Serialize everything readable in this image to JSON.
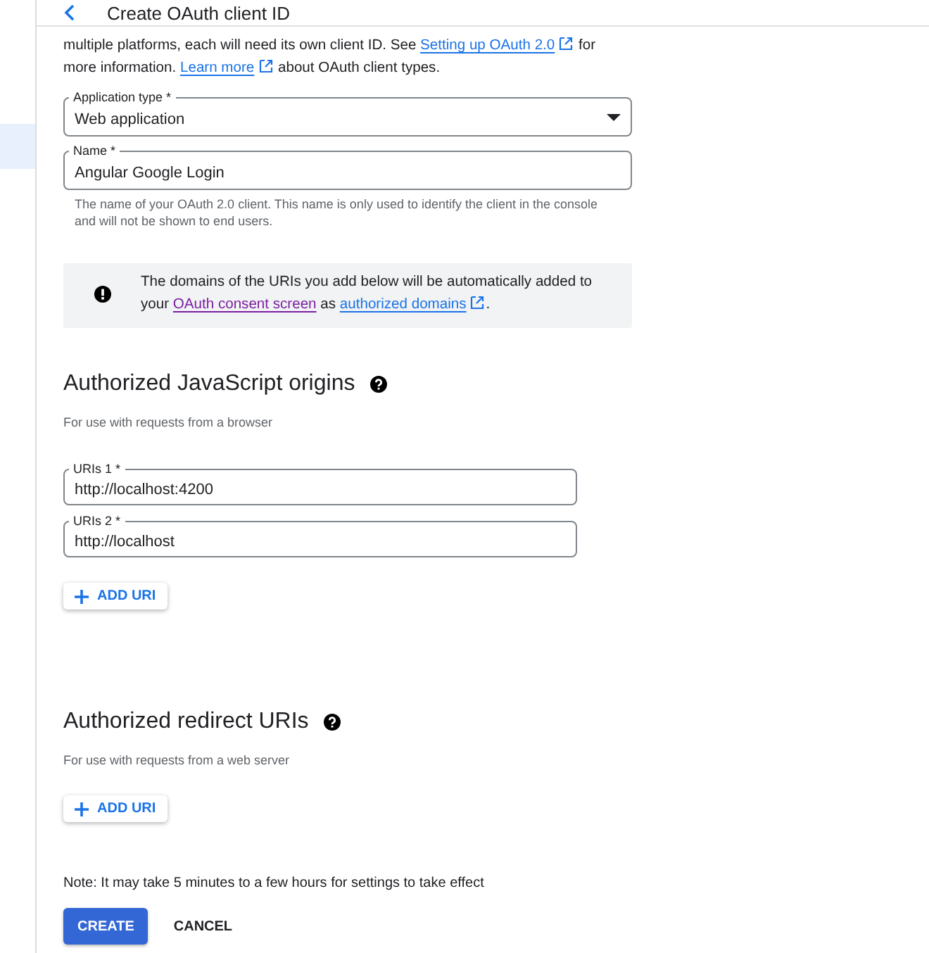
{
  "header": {
    "title": "Create OAuth client ID"
  },
  "intro": [
    {
      "kind": "text",
      "text": "multiple platforms, each will need its own client ID. See "
    },
    {
      "kind": "link",
      "text": "Setting up OAuth 2.0",
      "external": true,
      "visited": false
    },
    {
      "kind": "text",
      "text": " for more information. "
    },
    {
      "kind": "link",
      "text": "Learn more",
      "external": true,
      "visited": false
    },
    {
      "kind": "text",
      "text": " about OAuth client types."
    }
  ],
  "fields": [
    {
      "kind": "select",
      "label": "Application type *",
      "value": "Web application"
    },
    {
      "kind": "text",
      "label": "Name *",
      "value": "Angular Google Login",
      "helper": "The name of your OAuth 2.0 client. This name is only used to identify the client in the console and will not be shown to end users."
    }
  ],
  "info": [
    {
      "kind": "text",
      "text": "The domains of the URIs you add below will be automatically added to your "
    },
    {
      "kind": "link",
      "text": "OAuth consent screen",
      "external": false,
      "visited": true
    },
    {
      "kind": "text",
      "text": " as "
    },
    {
      "kind": "link",
      "text": "authorized domains",
      "external": true,
      "visited": false
    },
    {
      "kind": "text",
      "text": "."
    }
  ],
  "sections": [
    {
      "heading": "Authorized JavaScript origins",
      "subtitle": "For use with requests from a browser",
      "uris": [
        {
          "label": "URIs 1 *",
          "value": "http://localhost:4200"
        },
        {
          "label": "URIs 2 *",
          "value": "http://localhost"
        }
      ],
      "add_button": "ADD URI"
    },
    {
      "heading": "Authorized redirect URIs",
      "subtitle": "For use with requests from a web server",
      "add_button": "ADD URI"
    }
  ],
  "note": "Note: It may take 5 minutes to a few hours for settings to take effect",
  "buttons": [
    {
      "label": "CREATE",
      "kind": "primary"
    },
    {
      "label": "CANCEL",
      "kind": "text"
    }
  ]
}
